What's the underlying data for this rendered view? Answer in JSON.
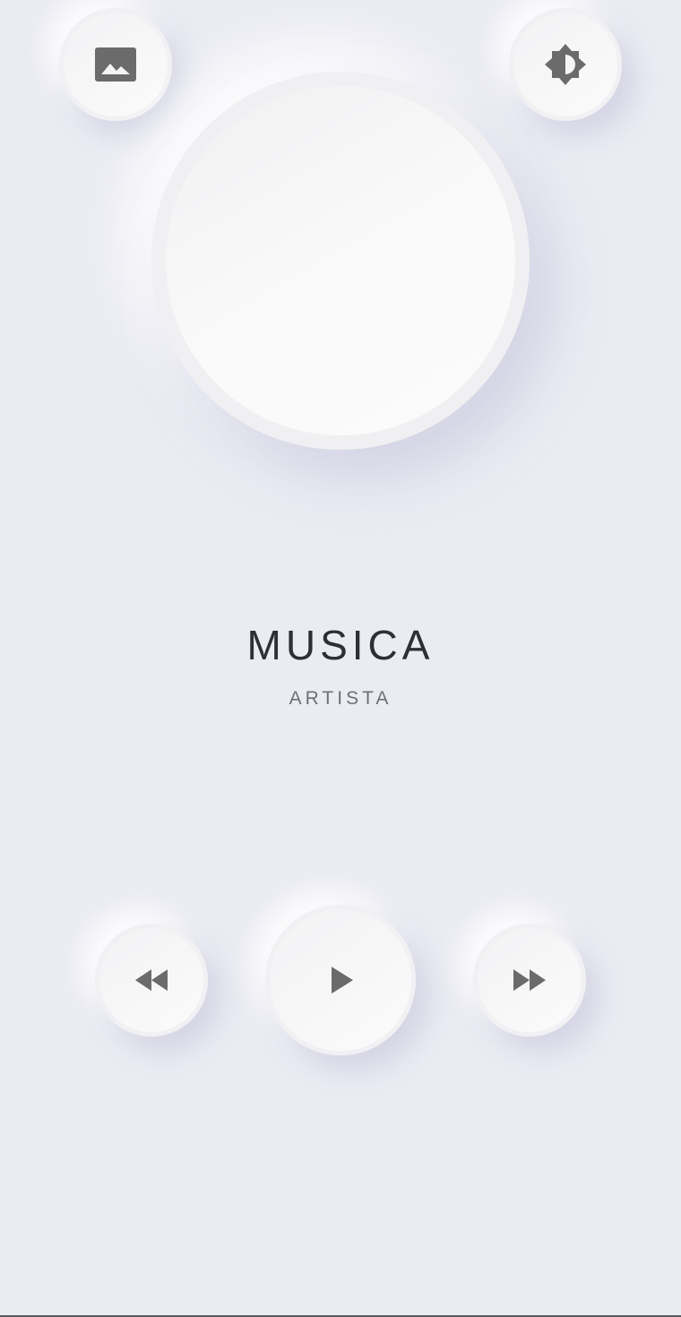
{
  "header": {
    "left_button_icon": "image-icon",
    "right_button_icon": "brightness-icon"
  },
  "album_art": {
    "icon": "none"
  },
  "track": {
    "title": "MUSICA",
    "artist": "ARTISTA"
  },
  "controls": {
    "previous_icon": "fast-rewind-icon",
    "play_icon": "play-icon",
    "next_icon": "fast-forward-icon"
  },
  "colors": {
    "background": "#ebebf3",
    "surface": "#f7f7f8",
    "icon": "#6b6b6b",
    "title_text": "#2e2e36",
    "artist_text": "#6f6f78"
  }
}
